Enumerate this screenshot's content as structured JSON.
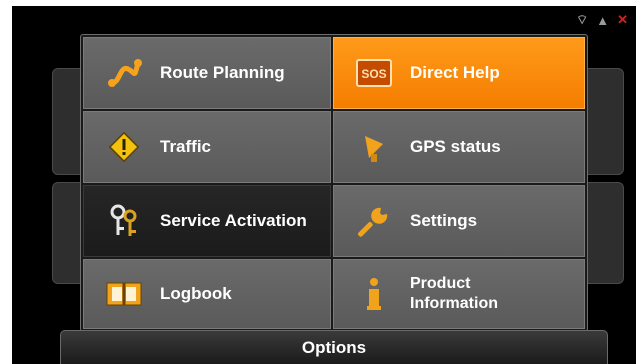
{
  "status_icons": [
    "satellite-icon",
    "warning-icon",
    "flag-icon"
  ],
  "menu": [
    {
      "label": "Route Planning",
      "icon": "route-icon"
    },
    {
      "label": "Direct Help",
      "icon": "sos-icon",
      "active": true,
      "accent": "#f58a00"
    },
    {
      "label": "Traffic",
      "icon": "traffic-warning-icon"
    },
    {
      "label": "GPS status",
      "icon": "satellite-dish-icon"
    },
    {
      "label": "Service Activation",
      "icon": "keys-icon",
      "selected": true
    },
    {
      "label": "Settings",
      "icon": "wrench-icon"
    },
    {
      "label": "Logbook",
      "icon": "logbook-icon"
    },
    {
      "label": "Product Information",
      "line1": "Product",
      "line2": "Information",
      "icon": "info-icon"
    }
  ],
  "footer": {
    "options_label": "Options"
  }
}
